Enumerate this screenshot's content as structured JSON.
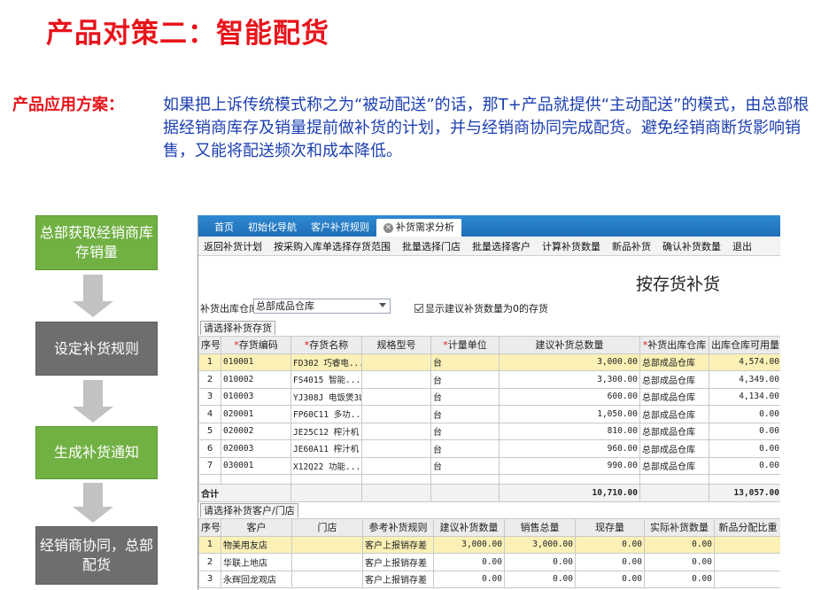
{
  "slide": {
    "title": "产品对策二：智能配货",
    "solution_label": "产品应用方案：",
    "solution_text": "如果把上诉传统模式称之为“被动配送”的话，那T+产品就提供“主动配送”的模式，由总部根据经销商库存及销量提前做补货的计划，并与经销商协同完成配货。避免经销商断货影响销售，又能将配送频次和成本降低。"
  },
  "colors": {
    "title_red": "#e8141b",
    "text_blue": "#1c3fb0",
    "step_green": "#71b043",
    "step_gray": "#6e6e6e",
    "arrow_gray": "#c2c2c2",
    "tab_blue": "#1f6fb7",
    "row_highlight": "#fbf1b6"
  },
  "flow": {
    "steps": [
      "总部获取经销商库存销量",
      "设定补货规则",
      "生成补货通知",
      "经销商协同，总部配货"
    ]
  },
  "app": {
    "tabs": [
      "首页",
      "初始化导航",
      "客户补货规则",
      "补货需求分析"
    ],
    "toolbar": [
      "返回补货计划",
      "按采购入库单选择存货范围",
      "批量选择门店",
      "批量选择客户",
      "计算补货数量",
      "新品补货",
      "确认补货数量",
      "退出"
    ],
    "form_title": "按存货补货",
    "warehouse_label": "补货出库仓库",
    "warehouse_value": "总部成品仓库",
    "show_zero_label": "显示建议补货数量为0的存货",
    "inventory_section": "请选择补货存货",
    "inventory_columns": [
      "序号",
      "存货编码",
      "存货名称",
      "规格型号",
      "计量单位",
      "建议补货总数量",
      "补货出库仓库",
      "出库仓库可用量"
    ],
    "inventory_rows": [
      {
        "seq": "1",
        "code": "010001",
        "name": "FD302 巧睿电...",
        "spec": "",
        "unit": "台",
        "qty": "3,000.00",
        "warehouse": "总部成品仓库",
        "available": "4,574.00"
      },
      {
        "seq": "2",
        "code": "010002",
        "name": "FS4015 智能...",
        "spec": "",
        "unit": "台",
        "qty": "3,300.00",
        "warehouse": "总部成品仓库",
        "available": "4,349.00"
      },
      {
        "seq": "3",
        "code": "010003",
        "name": "YJ308J 电饭煲3L",
        "spec": "",
        "unit": "台",
        "qty": "600.00",
        "warehouse": "总部成品仓库",
        "available": "4,134.00"
      },
      {
        "seq": "4",
        "code": "020001",
        "name": "FP60C11 多功...",
        "spec": "",
        "unit": "台",
        "qty": "1,050.00",
        "warehouse": "总部成品仓库",
        "available": "0.00"
      },
      {
        "seq": "5",
        "code": "020002",
        "name": "JE25C12 榨汁机",
        "spec": "",
        "unit": "台",
        "qty": "810.00",
        "warehouse": "总部成品仓库",
        "available": "0.00"
      },
      {
        "seq": "6",
        "code": "020003",
        "name": "JE60A11 榨汁机",
        "spec": "",
        "unit": "台",
        "qty": "960.00",
        "warehouse": "总部成品仓库",
        "available": "0.00"
      },
      {
        "seq": "7",
        "code": "030001",
        "name": "X12Q22 功能...",
        "spec": "",
        "unit": "台",
        "qty": "990.00",
        "warehouse": "总部成品仓库",
        "available": "0.00"
      }
    ],
    "inventory_total": {
      "label": "合计",
      "qty": "10,710.00",
      "available": "13,057.00"
    },
    "customer_section": "请选择补货客户/门店",
    "customer_columns": [
      "序号",
      "客户",
      "门店",
      "参考补货规则",
      "建议补货数量",
      "销售总量",
      "现存量",
      "实际补货数量",
      "新品分配比重"
    ],
    "customer_rows": [
      {
        "seq": "1",
        "customer": "物美用友店",
        "store": "",
        "rule": "客户上报销存差",
        "suggested": "3,000.00",
        "sales": "3,000.00",
        "stock": "0.00",
        "actual": "0.00",
        "ratio": ""
      },
      {
        "seq": "2",
        "customer": "华联上地店",
        "store": "",
        "rule": "客户上报销存差",
        "suggested": "0.00",
        "sales": "0.00",
        "stock": "0.00",
        "actual": "0.00",
        "ratio": ""
      },
      {
        "seq": "3",
        "customer": "永辉回龙观店",
        "store": "",
        "rule": "客户上报销存差",
        "suggested": "0.00",
        "sales": "0.00",
        "stock": "0.00",
        "actual": "0.00",
        "ratio": ""
      }
    ]
  }
}
